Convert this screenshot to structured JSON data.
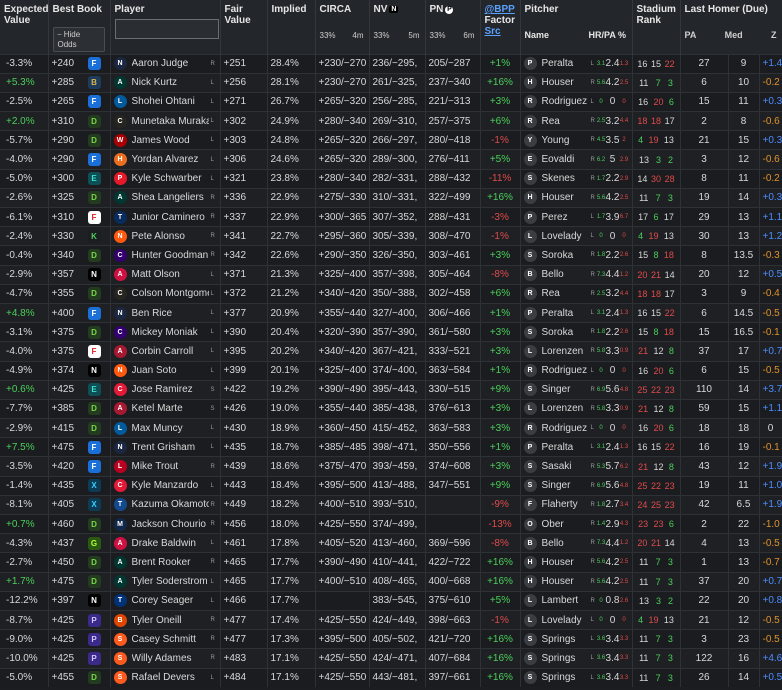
{
  "headers": {
    "expected_value": "Expected Value",
    "best_book": "Best Book",
    "hide_odds": "⎯ Hide Odds",
    "player": "Player",
    "fair_value": "Fair Value",
    "implied": "Implied",
    "circa": "CIRCA",
    "circa_pct": "33%",
    "circa_time": "4m",
    "nv": "NV",
    "nv_pct": "33%",
    "nv_time": "5m",
    "pn": "PN",
    "pn_pct": "33%",
    "pn_time": "6m",
    "bpp_link": "@BPP",
    "factor": "Factor",
    "src_link": "Src",
    "pitcher": "Pitcher",
    "pitcher_name": "Name",
    "hrpa": "HR/PA %",
    "stadium_rank": "Stadium Rank",
    "last_homer": "Last Homer (Due)",
    "pa": "PA",
    "med": "Med",
    "z": "Z"
  },
  "colors": {
    "positive": "#4ccf5a",
    "negative": "#e04b4b",
    "zpos": "#4c8dff",
    "zneg": "#e0922b",
    "bg": "#1b1d20"
  },
  "rows": [
    {
      "ev": "-3.3%",
      "book": "+240",
      "book_icon": "fd",
      "player": "Aaron Judge",
      "hand": "R",
      "team": "NYY",
      "fair": "+251",
      "implied": "28.4%",
      "circa": "+230/−270",
      "nv": "236/−295,",
      "pn": "205/−287",
      "factor": "+1%",
      "pitcher": "Peralta",
      "phand": "L",
      "ph1": "3.1",
      "ph2": "2.4",
      "ph3": "1.3",
      "sr1": "16",
      "sr2": "15",
      "sr3": "22",
      "pa": "27",
      "med": "9",
      "z": "+1.4"
    },
    {
      "ev": "+5.3%",
      "book": "+285",
      "book_icon": "br",
      "player": "Nick Kurtz",
      "hand": "L",
      "team": "ATH",
      "fair": "+256",
      "implied": "28.1%",
      "circa": "+230/−270",
      "nv": "261/−325,",
      "pn": "237/−340",
      "factor": "+16%",
      "pitcher": "Houser",
      "phand": "R",
      "ph1": "5.6",
      "ph2": "4.2",
      "ph3": "2.5",
      "sr1": "11",
      "sr2": "7",
      "sr3": "3",
      "pa": "6",
      "med": "10",
      "z": "-0.2"
    },
    {
      "ev": "-2.5%",
      "book": "+265",
      "book_icon": "fd",
      "player": "Shohei Ohtani",
      "hand": "L",
      "team": "LAD",
      "fair": "+271",
      "implied": "26.7%",
      "circa": "+265/−320",
      "nv": "256/−285,",
      "pn": "221/−313",
      "factor": "+3%",
      "pitcher": "Rodriguez",
      "phand": "L",
      "ph1": "0",
      "ph2": "0",
      "ph3": "0",
      "sr1": "16",
      "sr2": "20",
      "sr3": "6",
      "pa": "15",
      "med": "11",
      "z": "+0.3"
    },
    {
      "ev": "+2.0%",
      "book": "+310",
      "book_icon": "dk",
      "player": "Munetaka Muraka...",
      "hand": "L",
      "team": "CHW",
      "fair": "+302",
      "implied": "24.9%",
      "circa": "+280/−340",
      "nv": "269/−310,",
      "pn": "257/−375",
      "factor": "+6%",
      "pitcher": "Rea",
      "phand": "R",
      "ph1": "2.5",
      "ph2": "3.2",
      "ph3": "4.4",
      "sr1": "18",
      "sr2": "18",
      "sr3": "17",
      "pa": "2",
      "med": "8",
      "z": "-0.6"
    },
    {
      "ev": "-5.7%",
      "book": "+290",
      "book_icon": "dk",
      "player": "James Wood",
      "hand": "L",
      "team": "WSH",
      "fair": "+303",
      "implied": "24.8%",
      "circa": "+265/−320",
      "nv": "266/−297,",
      "pn": "280/−418",
      "factor": "-1%",
      "pitcher": "Young",
      "phand": "R",
      "ph1": "4.5",
      "ph2": "3.5",
      "ph3": "2",
      "sr1": "4",
      "sr2": "19",
      "sr3": "13",
      "pa": "21",
      "med": "15",
      "z": "+0.3"
    },
    {
      "ev": "-4.0%",
      "book": "+290",
      "book_icon": "fd",
      "player": "Yordan Alvarez",
      "hand": "L",
      "team": "HOU",
      "fair": "+306",
      "implied": "24.6%",
      "circa": "+265/−320",
      "nv": "289/−300,",
      "pn": "276/−411",
      "factor": "+5%",
      "pitcher": "Eovaldi",
      "phand": "R",
      "ph1": "6.2",
      "ph2": "5",
      "ph3": "2.9",
      "sr1": "13",
      "sr2": "3",
      "sr3": "2",
      "pa": "3",
      "med": "12",
      "z": "-0.6"
    },
    {
      "ev": "-5.0%",
      "book": "+300",
      "book_icon": "ez",
      "player": "Kyle Schwarber",
      "hand": "L",
      "team": "PHI",
      "fair": "+321",
      "implied": "23.8%",
      "circa": "+280/−340",
      "nv": "282/−331,",
      "pn": "288/−432",
      "factor": "-11%",
      "pitcher": "Skenes",
      "phand": "R",
      "ph1": "1.7",
      "ph2": "2.2",
      "ph3": "2.9",
      "sr1": "14",
      "sr2": "30",
      "sr3": "28",
      "pa": "8",
      "med": "11",
      "z": "-0.2"
    },
    {
      "ev": "-2.6%",
      "book": "+325",
      "book_icon": "dk",
      "player": "Shea Langeliers",
      "hand": "R",
      "team": "ATH",
      "fair": "+336",
      "implied": "22.9%",
      "circa": "+275/−330",
      "nv": "310/−331,",
      "pn": "322/−499",
      "factor": "+16%",
      "pitcher": "Houser",
      "phand": "R",
      "ph1": "5.6",
      "ph2": "4.2",
      "ph3": "2.5",
      "sr1": "11",
      "sr2": "7",
      "sr3": "3",
      "pa": "19",
      "med": "14",
      "z": "+0.3"
    },
    {
      "ev": "-6.1%",
      "book": "+310",
      "book_icon": "fn",
      "player": "Junior Caminero",
      "hand": "R",
      "team": "TB",
      "fair": "+337",
      "implied": "22.9%",
      "circa": "+300/−365",
      "nv": "307/−352,",
      "pn": "288/−431",
      "factor": "-3%",
      "pitcher": "Perez",
      "phand": "L",
      "ph1": "1.7",
      "ph2": "3.9",
      "ph3": "6.7",
      "sr1": "17",
      "sr2": "6",
      "sr3": "17",
      "pa": "29",
      "med": "13",
      "z": "+1.1"
    },
    {
      "ev": "-2.4%",
      "book": "+330",
      "book_icon": "kl",
      "player": "Pete Alonso",
      "hand": "R",
      "team": "NYM",
      "fair": "+341",
      "implied": "22.7%",
      "circa": "+295/−360",
      "nv": "305/−339,",
      "pn": "308/−470",
      "factor": "-1%",
      "pitcher": "Lovelady",
      "phand": "L",
      "ph1": "0",
      "ph2": "0",
      "ph3": "0",
      "sr1": "4",
      "sr2": "19",
      "sr3": "13",
      "pa": "30",
      "med": "13",
      "z": "+1.2"
    },
    {
      "ev": "-0.4%",
      "book": "+340",
      "book_icon": "dk",
      "player": "Hunter Goodman",
      "hand": "R",
      "team": "COL",
      "fair": "+342",
      "implied": "22.6%",
      "circa": "+290/−350",
      "nv": "326/−350,",
      "pn": "303/−461",
      "factor": "+3%",
      "pitcher": "Soroka",
      "phand": "R",
      "ph1": "1.8",
      "ph2": "2.2",
      "ph3": "2.6",
      "sr1": "15",
      "sr2": "8",
      "sr3": "18",
      "pa": "8",
      "med": "13.5",
      "z": "-0.3"
    },
    {
      "ev": "-2.9%",
      "book": "+357",
      "book_icon": "nv",
      "player": "Matt Olson",
      "hand": "L",
      "team": "ATL",
      "fair": "+371",
      "implied": "21.3%",
      "circa": "+325/−400",
      "nv": "357/−398,",
      "pn": "305/−464",
      "factor": "-8%",
      "pitcher": "Bello",
      "phand": "R",
      "ph1": "7.3",
      "ph2": "4.4",
      "ph3": "1.2",
      "sr1": "20",
      "sr2": "21",
      "sr3": "14",
      "pa": "20",
      "med": "12",
      "z": "+0.5"
    },
    {
      "ev": "-4.7%",
      "book": "+355",
      "book_icon": "dk",
      "player": "Colson Montgome...",
      "hand": "L",
      "team": "CHW",
      "fair": "+372",
      "implied": "21.2%",
      "circa": "+340/−420",
      "nv": "350/−388,",
      "pn": "302/−458",
      "factor": "+6%",
      "pitcher": "Rea",
      "phand": "R",
      "ph1": "2.5",
      "ph2": "3.2",
      "ph3": "4.4",
      "sr1": "18",
      "sr2": "18",
      "sr3": "17",
      "pa": "3",
      "med": "9",
      "z": "-0.4"
    },
    {
      "ev": "+4.8%",
      "book": "+400",
      "book_icon": "fd",
      "player": "Ben Rice",
      "hand": "L",
      "team": "NYY",
      "fair": "+377",
      "implied": "20.9%",
      "circa": "+355/−440",
      "nv": "327/−400,",
      "pn": "306/−466",
      "factor": "+1%",
      "pitcher": "Peralta",
      "phand": "L",
      "ph1": "3.1",
      "ph2": "2.4",
      "ph3": "1.3",
      "sr1": "16",
      "sr2": "15",
      "sr3": "22",
      "pa": "6",
      "med": "14.5",
      "z": "-0.5"
    },
    {
      "ev": "-3.1%",
      "book": "+375",
      "book_icon": "dk",
      "player": "Mickey Moniak",
      "hand": "L",
      "team": "COL",
      "fair": "+390",
      "implied": "20.4%",
      "circa": "+320/−390",
      "nv": "357/−390,",
      "pn": "361/−580",
      "factor": "+3%",
      "pitcher": "Soroka",
      "phand": "R",
      "ph1": "1.8",
      "ph2": "2.2",
      "ph3": "2.6",
      "sr1": "15",
      "sr2": "8",
      "sr3": "18",
      "pa": "15",
      "med": "16.5",
      "z": "-0.1"
    },
    {
      "ev": "-4.0%",
      "book": "+375",
      "book_icon": "fn",
      "player": "Corbin Carroll",
      "hand": "L",
      "team": "ARI",
      "fair": "+395",
      "implied": "20.2%",
      "circa": "+340/−420",
      "nv": "367/−421,",
      "pn": "333/−521",
      "factor": "+3%",
      "pitcher": "Lorenzen",
      "phand": "R",
      "ph1": "5.8",
      "ph2": "3.3",
      "ph3": "0.9",
      "sr1": "21",
      "sr2": "12",
      "sr3": "8",
      "pa": "37",
      "med": "17",
      "z": "+0.7"
    },
    {
      "ev": "-4.9%",
      "book": "+374",
      "book_icon": "nv",
      "player": "Juan Soto",
      "hand": "L",
      "team": "NYM",
      "fair": "+399",
      "implied": "20.1%",
      "circa": "+325/−400",
      "nv": "374/−400,",
      "pn": "363/−584",
      "factor": "+1%",
      "pitcher": "Rodriguez",
      "phand": "L",
      "ph1": "0",
      "ph2": "0",
      "ph3": "0",
      "sr1": "16",
      "sr2": "20",
      "sr3": "6",
      "pa": "6",
      "med": "15",
      "z": "-0.5"
    },
    {
      "ev": "+0.6%",
      "book": "+425",
      "book_icon": "ez",
      "player": "Jose Ramirez",
      "hand": "S",
      "team": "CLE",
      "fair": "+422",
      "implied": "19.2%",
      "circa": "+390/−490",
      "nv": "395/−443,",
      "pn": "330/−515",
      "factor": "+9%",
      "pitcher": "Singer",
      "phand": "R",
      "ph1": "6.9",
      "ph2": "5.6",
      "ph3": "4.8",
      "sr1": "25",
      "sr2": "22",
      "sr3": "23",
      "pa": "110",
      "med": "14",
      "z": "+3.7"
    },
    {
      "ev": "-7.7%",
      "book": "+385",
      "book_icon": "dk",
      "player": "Ketel Marte",
      "hand": "S",
      "team": "ARI",
      "fair": "+426",
      "implied": "19.0%",
      "circa": "+355/−440",
      "nv": "385/−438,",
      "pn": "376/−613",
      "factor": "+3%",
      "pitcher": "Lorenzen",
      "phand": "R",
      "ph1": "5.8",
      "ph2": "3.3",
      "ph3": "0.9",
      "sr1": "21",
      "sr2": "12",
      "sr3": "8",
      "pa": "59",
      "med": "15",
      "z": "+1.1"
    },
    {
      "ev": "-2.9%",
      "book": "+415",
      "book_icon": "dk",
      "player": "Max Muncy",
      "hand": "L",
      "team": "LAD",
      "fair": "+430",
      "implied": "18.9%",
      "circa": "+360/−450",
      "nv": "415/−452,",
      "pn": "363/−583",
      "factor": "+3%",
      "pitcher": "Rodriguez",
      "phand": "L",
      "ph1": "0",
      "ph2": "0",
      "ph3": "0",
      "sr1": "16",
      "sr2": "20",
      "sr3": "6",
      "pa": "18",
      "med": "18",
      "z": "0"
    },
    {
      "ev": "+7.5%",
      "book": "+475",
      "book_icon": "fd",
      "player": "Trent Grisham",
      "hand": "L",
      "team": "NYY",
      "fair": "+435",
      "implied": "18.7%",
      "circa": "+385/−485",
      "nv": "398/−471,",
      "pn": "350/−556",
      "factor": "+1%",
      "pitcher": "Peralta",
      "phand": "L",
      "ph1": "3.1",
      "ph2": "2.4",
      "ph3": "1.3",
      "sr1": "16",
      "sr2": "15",
      "sr3": "22",
      "pa": "16",
      "med": "19",
      "z": "-0.1"
    },
    {
      "ev": "-3.5%",
      "book": "+420",
      "book_icon": "fd",
      "player": "Mike Trout",
      "hand": "R",
      "team": "LAA",
      "fair": "+439",
      "implied": "18.6%",
      "circa": "+375/−470",
      "nv": "393/−459,",
      "pn": "374/−608",
      "factor": "+3%",
      "pitcher": "Sasaki",
      "phand": "R",
      "ph1": "5.3",
      "ph2": "5.7",
      "ph3": "6.2",
      "sr1": "21",
      "sr2": "12",
      "sr3": "8",
      "pa": "43",
      "med": "12",
      "z": "+1.9"
    },
    {
      "ev": "-1.4%",
      "book": "+435",
      "book_icon": "bx",
      "player": "Kyle Manzardo",
      "hand": "L",
      "team": "CLE",
      "fair": "+443",
      "implied": "18.4%",
      "circa": "+395/−500",
      "nv": "413/−488,",
      "pn": "347/−551",
      "factor": "+9%",
      "pitcher": "Singer",
      "phand": "R",
      "ph1": "6.9",
      "ph2": "5.6",
      "ph3": "4.8",
      "sr1": "25",
      "sr2": "22",
      "sr3": "23",
      "pa": "19",
      "med": "11",
      "z": "+1.0"
    },
    {
      "ev": "-8.1%",
      "book": "+405",
      "book_icon": "bx",
      "player": "Kazuma Okamoto",
      "hand": "R",
      "team": "TOR",
      "fair": "+449",
      "implied": "18.2%",
      "circa": "+400/−510",
      "nv": "393/−510,",
      "pn": "",
      "factor": "-9%",
      "pitcher": "Flaherty",
      "phand": "R",
      "ph1": "1.8",
      "ph2": "2.7",
      "ph3": "3.4",
      "sr1": "24",
      "sr2": "25",
      "sr3": "23",
      "pa": "42",
      "med": "6.5",
      "z": "+1.9"
    },
    {
      "ev": "+0.7%",
      "book": "+460",
      "book_icon": "dk",
      "player": "Jackson Chourio",
      "hand": "R",
      "team": "MIL",
      "fair": "+456",
      "implied": "18.0%",
      "circa": "+425/−550",
      "nv": "374/−499,",
      "pn": "",
      "factor": "-13%",
      "pitcher": "Ober",
      "phand": "R",
      "ph1": "1.4",
      "ph2": "2.9",
      "ph3": "4.3",
      "sr1": "23",
      "sr2": "23",
      "sr3": "6",
      "pa": "2",
      "med": "22",
      "z": "-1.0"
    },
    {
      "ev": "-4.3%",
      "book": "+437",
      "book_icon": "gr",
      "player": "Drake Baldwin",
      "hand": "L",
      "team": "ATL",
      "fair": "+461",
      "implied": "17.8%",
      "circa": "+405/−520",
      "nv": "413/−460,",
      "pn": "369/−596",
      "factor": "-8%",
      "pitcher": "Bello",
      "phand": "R",
      "ph1": "7.3",
      "ph2": "4.4",
      "ph3": "1.2",
      "sr1": "20",
      "sr2": "21",
      "sr3": "14",
      "pa": "4",
      "med": "13",
      "z": "-0.5"
    },
    {
      "ev": "-2.7%",
      "book": "+450",
      "book_icon": "dk",
      "player": "Brent Rooker",
      "hand": "R",
      "team": "ATH",
      "fair": "+465",
      "implied": "17.7%",
      "circa": "+390/−490",
      "nv": "410/−441,",
      "pn": "422/−722",
      "factor": "+16%",
      "pitcher": "Houser",
      "phand": "R",
      "ph1": "5.6",
      "ph2": "4.2",
      "ph3": "2.5",
      "sr1": "11",
      "sr2": "7",
      "sr3": "3",
      "pa": "1",
      "med": "13",
      "z": "-0.7"
    },
    {
      "ev": "+1.7%",
      "book": "+475",
      "book_icon": "dk",
      "player": "Tyler Soderstrom",
      "hand": "L",
      "team": "ATH",
      "fair": "+465",
      "implied": "17.7%",
      "circa": "+400/−510",
      "nv": "408/−465,",
      "pn": "400/−668",
      "factor": "+16%",
      "pitcher": "Houser",
      "phand": "R",
      "ph1": "5.6",
      "ph2": "4.2",
      "ph3": "2.5",
      "sr1": "11",
      "sr2": "7",
      "sr3": "3",
      "pa": "37",
      "med": "20",
      "z": "+0.7"
    },
    {
      "ev": "-12.2%",
      "book": "+397",
      "book_icon": "nv",
      "player": "Corey Seager",
      "hand": "L",
      "team": "TEX",
      "fair": "+466",
      "implied": "17.7%",
      "circa": "",
      "nv": "383/−545,",
      "pn": "375/−610",
      "factor": "+5%",
      "pitcher": "Lambert",
      "phand": "R",
      "ph1": "0",
      "ph2": "0.8",
      "ph3": "2.6",
      "sr1": "13",
      "sr2": "3",
      "sr3": "2",
      "pa": "22",
      "med": "20",
      "z": "+0.8"
    },
    {
      "ev": "-8.7%",
      "book": "+425",
      "book_icon": "pp",
      "player": "Tyler Oneill",
      "hand": "R",
      "team": "BAL",
      "fair": "+477",
      "implied": "17.4%",
      "circa": "+425/−550",
      "nv": "424/−449,",
      "pn": "398/−663",
      "factor": "-1%",
      "pitcher": "Lovelady",
      "phand": "L",
      "ph1": "0",
      "ph2": "0",
      "ph3": "0",
      "sr1": "4",
      "sr2": "19",
      "sr3": "13",
      "pa": "21",
      "med": "12",
      "z": "-0.5"
    },
    {
      "ev": "-9.0%",
      "book": "+425",
      "book_icon": "pp",
      "player": "Casey Schmitt",
      "hand": "R",
      "team": "SF",
      "fair": "+477",
      "implied": "17.3%",
      "circa": "+395/−500",
      "nv": "405/−502,",
      "pn": "421/−720",
      "factor": "+16%",
      "pitcher": "Springs",
      "phand": "L",
      "ph1": "3.6",
      "ph2": "3.4",
      "ph3": "3.3",
      "sr1": "11",
      "sr2": "7",
      "sr3": "3",
      "pa": "3",
      "med": "23",
      "z": "-0.5"
    },
    {
      "ev": "-10.0%",
      "book": "+425",
      "book_icon": "pp",
      "player": "Willy Adames",
      "hand": "R",
      "team": "SF",
      "fair": "+483",
      "implied": "17.1%",
      "circa": "+425/−550",
      "nv": "424/−471,",
      "pn": "407/−684",
      "factor": "+16%",
      "pitcher": "Springs",
      "phand": "L",
      "ph1": "3.6",
      "ph2": "3.4",
      "ph3": "3.3",
      "sr1": "11",
      "sr2": "7",
      "sr3": "3",
      "pa": "122",
      "med": "16",
      "z": "+4.6"
    },
    {
      "ev": "-5.0%",
      "book": "+455",
      "book_icon": "dk",
      "player": "Rafael Devers",
      "hand": "L",
      "team": "SF",
      "fair": "+484",
      "implied": "17.1%",
      "circa": "+425/−550",
      "nv": "443/−481,",
      "pn": "397/−661",
      "factor": "+16%",
      "pitcher": "Springs",
      "phand": "L",
      "ph1": "3.6",
      "ph2": "3.4",
      "ph3": "3.3",
      "sr1": "11",
      "sr2": "7",
      "sr3": "3",
      "pa": "26",
      "med": "14",
      "z": "+0.5"
    }
  ]
}
